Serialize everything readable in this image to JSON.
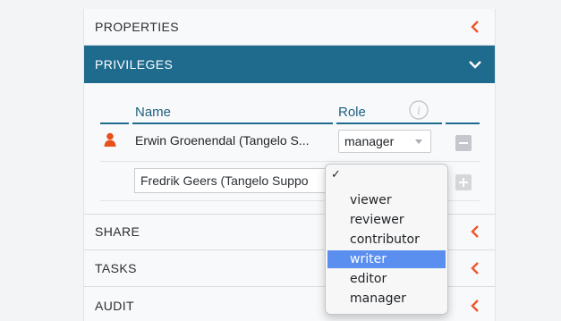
{
  "sections": {
    "properties": "PROPERTIES",
    "privileges": "PRIVILEGES",
    "share": "SHARE",
    "tasks": "TASKS",
    "audit": "AUDIT"
  },
  "privileges": {
    "columns": {
      "name": "Name",
      "role": "Role",
      "info_icon": "info-icon"
    },
    "users": [
      {
        "name": "Erwin Groenendal (Tangelo S...",
        "role": "manager",
        "icon": "person-icon"
      }
    ],
    "new_user_value": "Fredrik Geers (Tangelo Suppo"
  },
  "role_dropdown": {
    "checkmark": "✓",
    "options": [
      "viewer",
      "reviewer",
      "contributor",
      "writer",
      "editor",
      "manager"
    ],
    "highlighted": "writer"
  },
  "colors": {
    "header_active": "#1e6b8e",
    "chevron": "#f0552a",
    "highlight": "#5a8ff0",
    "user_icon": "#e8501e"
  }
}
